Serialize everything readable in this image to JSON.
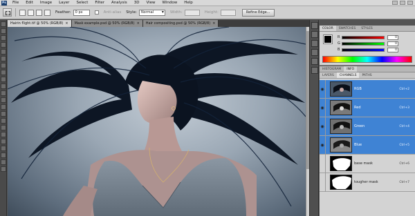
{
  "menubar": {
    "logo": "Ps",
    "items": [
      "File",
      "Edit",
      "Image",
      "Layer",
      "Select",
      "Filter",
      "Analysis",
      "3D",
      "View",
      "Window",
      "Help"
    ]
  },
  "options": {
    "feather_label": "Feather:",
    "feather_value": "0 px",
    "antialias_label": "Anti-alias",
    "style_label": "Style:",
    "style_value": "Normal",
    "width_label": "Width:",
    "height_label": "Height:",
    "refine_button": "Refine Edge..."
  },
  "tabs": [
    {
      "label": "Hairin flight.tif @ 50% (RGB/8)"
    },
    {
      "label": "Mask example.psd @ 50% (RGB/8)"
    },
    {
      "label": "Hair compositing.psd @ 50% (RGB/8)"
    }
  ],
  "color_panel": {
    "tabs": [
      "Color",
      "Swatches",
      "Styles"
    ],
    "sliders": [
      {
        "channel": "R",
        "value": "0",
        "gradient": "linear-gradient(90deg,#000,#f00)"
      },
      {
        "channel": "G",
        "value": "0",
        "gradient": "linear-gradient(90deg,#000,#0f0)"
      },
      {
        "channel": "B",
        "value": "0",
        "gradient": "linear-gradient(90deg,#000,#00f)"
      }
    ]
  },
  "channels_panel": {
    "tabs": [
      "Histogram",
      "Info"
    ],
    "subtabs": [
      "Layers",
      "Channels",
      "Paths"
    ],
    "rows": [
      {
        "name": "RGB",
        "shortcut": "Ctrl+2",
        "selected": true,
        "visible": true
      },
      {
        "name": "Red",
        "shortcut": "Ctrl+3",
        "selected": true,
        "visible": true
      },
      {
        "name": "Green",
        "shortcut": "Ctrl+4",
        "selected": true,
        "visible": true
      },
      {
        "name": "Blue",
        "shortcut": "Ctrl+5",
        "selected": true,
        "visible": true
      },
      {
        "name": "base mask",
        "shortcut": "Ctrl+6",
        "selected": false,
        "visible": false
      },
      {
        "name": "tougher mask",
        "shortcut": "Ctrl+7",
        "selected": false,
        "visible": false
      }
    ]
  },
  "colors": {
    "selection": "#3f83d4",
    "panel_bg": "#d3d3d3",
    "app_bg": "#535353"
  }
}
